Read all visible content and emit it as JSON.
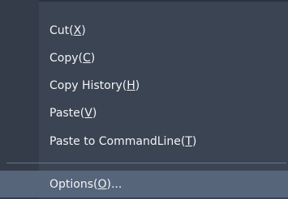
{
  "menu": {
    "items": [
      {
        "label": "Cut(",
        "mnemonic": "X",
        "suffix": ")"
      },
      {
        "label": "Copy(",
        "mnemonic": "C",
        "suffix": ")"
      },
      {
        "label": "Copy History(",
        "mnemonic": "H",
        "suffix": ")"
      },
      {
        "label": "Paste(",
        "mnemonic": "V",
        "suffix": ")"
      },
      {
        "label": "Paste to CommandLine(",
        "mnemonic": "T",
        "suffix": ")"
      },
      {
        "label": "Options(",
        "mnemonic": "O",
        "suffix": ")..."
      }
    ]
  }
}
